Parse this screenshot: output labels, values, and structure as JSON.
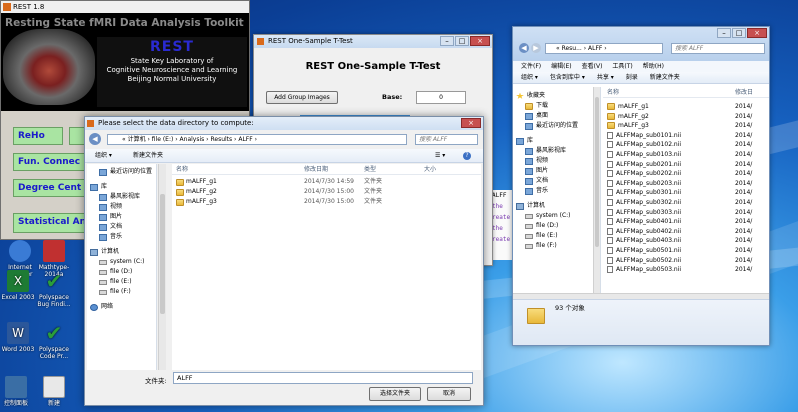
{
  "rest_main": {
    "title": "REST 1.8",
    "banner_title": "Resting State fMRI Data Analysis Toolkit",
    "logo": "REST",
    "lab_line1": "State Key Laboratory of",
    "lab_line2": "Cognitive Neuroscience and Learning",
    "lab_line3": "Beijing Normal University",
    "buttons": [
      "ReHo",
      "Fun. Connec",
      "Degree Cent",
      "Statistical An"
    ]
  },
  "desktop_icons": [
    {
      "label": "Internet Explorer",
      "color": "#3a7bd5"
    },
    {
      "label": "Mathtype-2014a",
      "color": "#c03030"
    },
    {
      "label": "Excel 2003",
      "color": "#1e7b34"
    },
    {
      "label": "Polyspace Bug Findi...",
      "color": "#2a9d3a"
    },
    {
      "label": "Word 2003",
      "color": "#2b579a"
    },
    {
      "label": "Polyspace Code Pr...",
      "color": "#2a9d3a"
    },
    {
      "label": "控制面板",
      "color": "#3a6ea5"
    },
    {
      "label": "新建",
      "color": "#e0e0e0"
    }
  ],
  "ttest": {
    "title": "REST One-Sample T-Test",
    "heading": "REST One-Sample T-Test",
    "add_button": "Add Group Images",
    "base_label": "Base:",
    "base_value": "0"
  },
  "explorer": {
    "address": "« Resu... › ALFF ›",
    "search_placeholder": "搜索 ALFF",
    "menu": [
      "文件(F)",
      "编辑(E)",
      "查看(V)",
      "工具(T)",
      "帮助(H)"
    ],
    "toolbar": [
      "组织 ▾",
      "包含到库中 ▾",
      "共享 ▾",
      "刻录",
      "新建文件夹"
    ],
    "nav": [
      {
        "label": "收藏夹",
        "icon": "star",
        "level": 0
      },
      {
        "label": "下载",
        "icon": "folder",
        "level": 1
      },
      {
        "label": "桌面",
        "icon": "lib",
        "level": 1
      },
      {
        "label": "最近访问的位置",
        "icon": "lib",
        "level": 1
      },
      {
        "label": "库",
        "icon": "lib",
        "level": 0
      },
      {
        "label": "暴风影视库",
        "icon": "lib",
        "level": 1
      },
      {
        "label": "视频",
        "icon": "lib",
        "level": 1
      },
      {
        "label": "图片",
        "icon": "lib",
        "level": 1
      },
      {
        "label": "文档",
        "icon": "lib",
        "level": 1
      },
      {
        "label": "音乐",
        "icon": "lib",
        "level": 1
      },
      {
        "label": "计算机",
        "icon": "pc",
        "level": 0
      },
      {
        "label": "system (C:)",
        "icon": "drive",
        "level": 1
      },
      {
        "label": "file (D:)",
        "icon": "drive",
        "level": 1
      },
      {
        "label": "file (E:)",
        "icon": "drive",
        "level": 1
      },
      {
        "label": "file (F:)",
        "icon": "drive",
        "level": 1
      }
    ],
    "col_name": "名称",
    "col_modified": "修改日",
    "files": [
      {
        "name": "mALFF_g1",
        "date": "2014/",
        "icon": "folder"
      },
      {
        "name": "mALFF_g2",
        "date": "2014/",
        "icon": "folder"
      },
      {
        "name": "mALFF_g3",
        "date": "2014/",
        "icon": "folder"
      },
      {
        "name": "ALFFMap_sub0101.nii",
        "date": "2014/",
        "icon": "file"
      },
      {
        "name": "ALFFMap_sub0102.nii",
        "date": "2014/",
        "icon": "file"
      },
      {
        "name": "ALFFMap_sub0103.nii",
        "date": "2014/",
        "icon": "file"
      },
      {
        "name": "ALFFMap_sub0201.nii",
        "date": "2014/",
        "icon": "file"
      },
      {
        "name": "ALFFMap_sub0202.nii",
        "date": "2014/",
        "icon": "file"
      },
      {
        "name": "ALFFMap_sub0203.nii",
        "date": "2014/",
        "icon": "file"
      },
      {
        "name": "ALFFMap_sub0301.nii",
        "date": "2014/",
        "icon": "file"
      },
      {
        "name": "ALFFMap_sub0302.nii",
        "date": "2014/",
        "icon": "file"
      },
      {
        "name": "ALFFMap_sub0303.nii",
        "date": "2014/",
        "icon": "file"
      },
      {
        "name": "ALFFMap_sub0401.nii",
        "date": "2014/",
        "icon": "file"
      },
      {
        "name": "ALFFMap_sub0402.nii",
        "date": "2014/",
        "icon": "file"
      },
      {
        "name": "ALFFMap_sub0403.nii",
        "date": "2014/",
        "icon": "file"
      },
      {
        "name": "ALFFMap_sub0501.nii",
        "date": "2014/",
        "icon": "file"
      },
      {
        "name": "ALFFMap_sub0502.nii",
        "date": "2014/",
        "icon": "file"
      },
      {
        "name": "ALFFMap_sub0503.nii",
        "date": "2014/",
        "icon": "file"
      }
    ],
    "status": "93 个对象"
  },
  "dialog": {
    "title": "Please select the data directory to compute:",
    "address": "« 计算机 › file (E:) › Analysis › Results › ALFF ›",
    "search_placeholder": "搜索 ALFF",
    "organize": "组织 ▾",
    "new_folder": "新建文件夹",
    "nav": [
      {
        "label": "最近访问的位置",
        "icon": "lib",
        "level": 1
      },
      {
        "label": "库",
        "icon": "lib",
        "level": 0
      },
      {
        "label": "暴风影视库",
        "icon": "lib",
        "level": 1
      },
      {
        "label": "视频",
        "icon": "lib",
        "level": 1
      },
      {
        "label": "图片",
        "icon": "lib",
        "level": 1
      },
      {
        "label": "文档",
        "icon": "lib",
        "level": 1
      },
      {
        "label": "音乐",
        "icon": "lib",
        "level": 1
      },
      {
        "label": "计算机",
        "icon": "pc",
        "level": 0
      },
      {
        "label": "system (C:)",
        "icon": "drive",
        "level": 1
      },
      {
        "label": "file (D:)",
        "icon": "drive",
        "level": 1
      },
      {
        "label": "file (E:)",
        "icon": "drive",
        "level": 1
      },
      {
        "label": "file (F:)",
        "icon": "drive",
        "level": 1
      },
      {
        "label": "网络",
        "icon": "netico",
        "level": 0
      }
    ],
    "columns": {
      "name": "名称",
      "modified": "修改日期",
      "type": "类型",
      "size": "大小"
    },
    "rows": [
      {
        "name": "mALFF_g1",
        "modified": "2014/7/30 14:59",
        "type": "文件夹"
      },
      {
        "name": "mALFF_g2",
        "modified": "2014/7/30 15:00",
        "type": "文件夹"
      },
      {
        "name": "mALFF_g3",
        "modified": "2014/7/30 15:00",
        "type": "文件夹"
      }
    ],
    "folder_label": "文件夹:",
    "folder_value": "ALFF",
    "select_button": "选择文件夹",
    "cancel_button": "取消"
  },
  "console_fragments": [
    "ALFF",
    "the",
    "reate",
    "the",
    "reate"
  ]
}
